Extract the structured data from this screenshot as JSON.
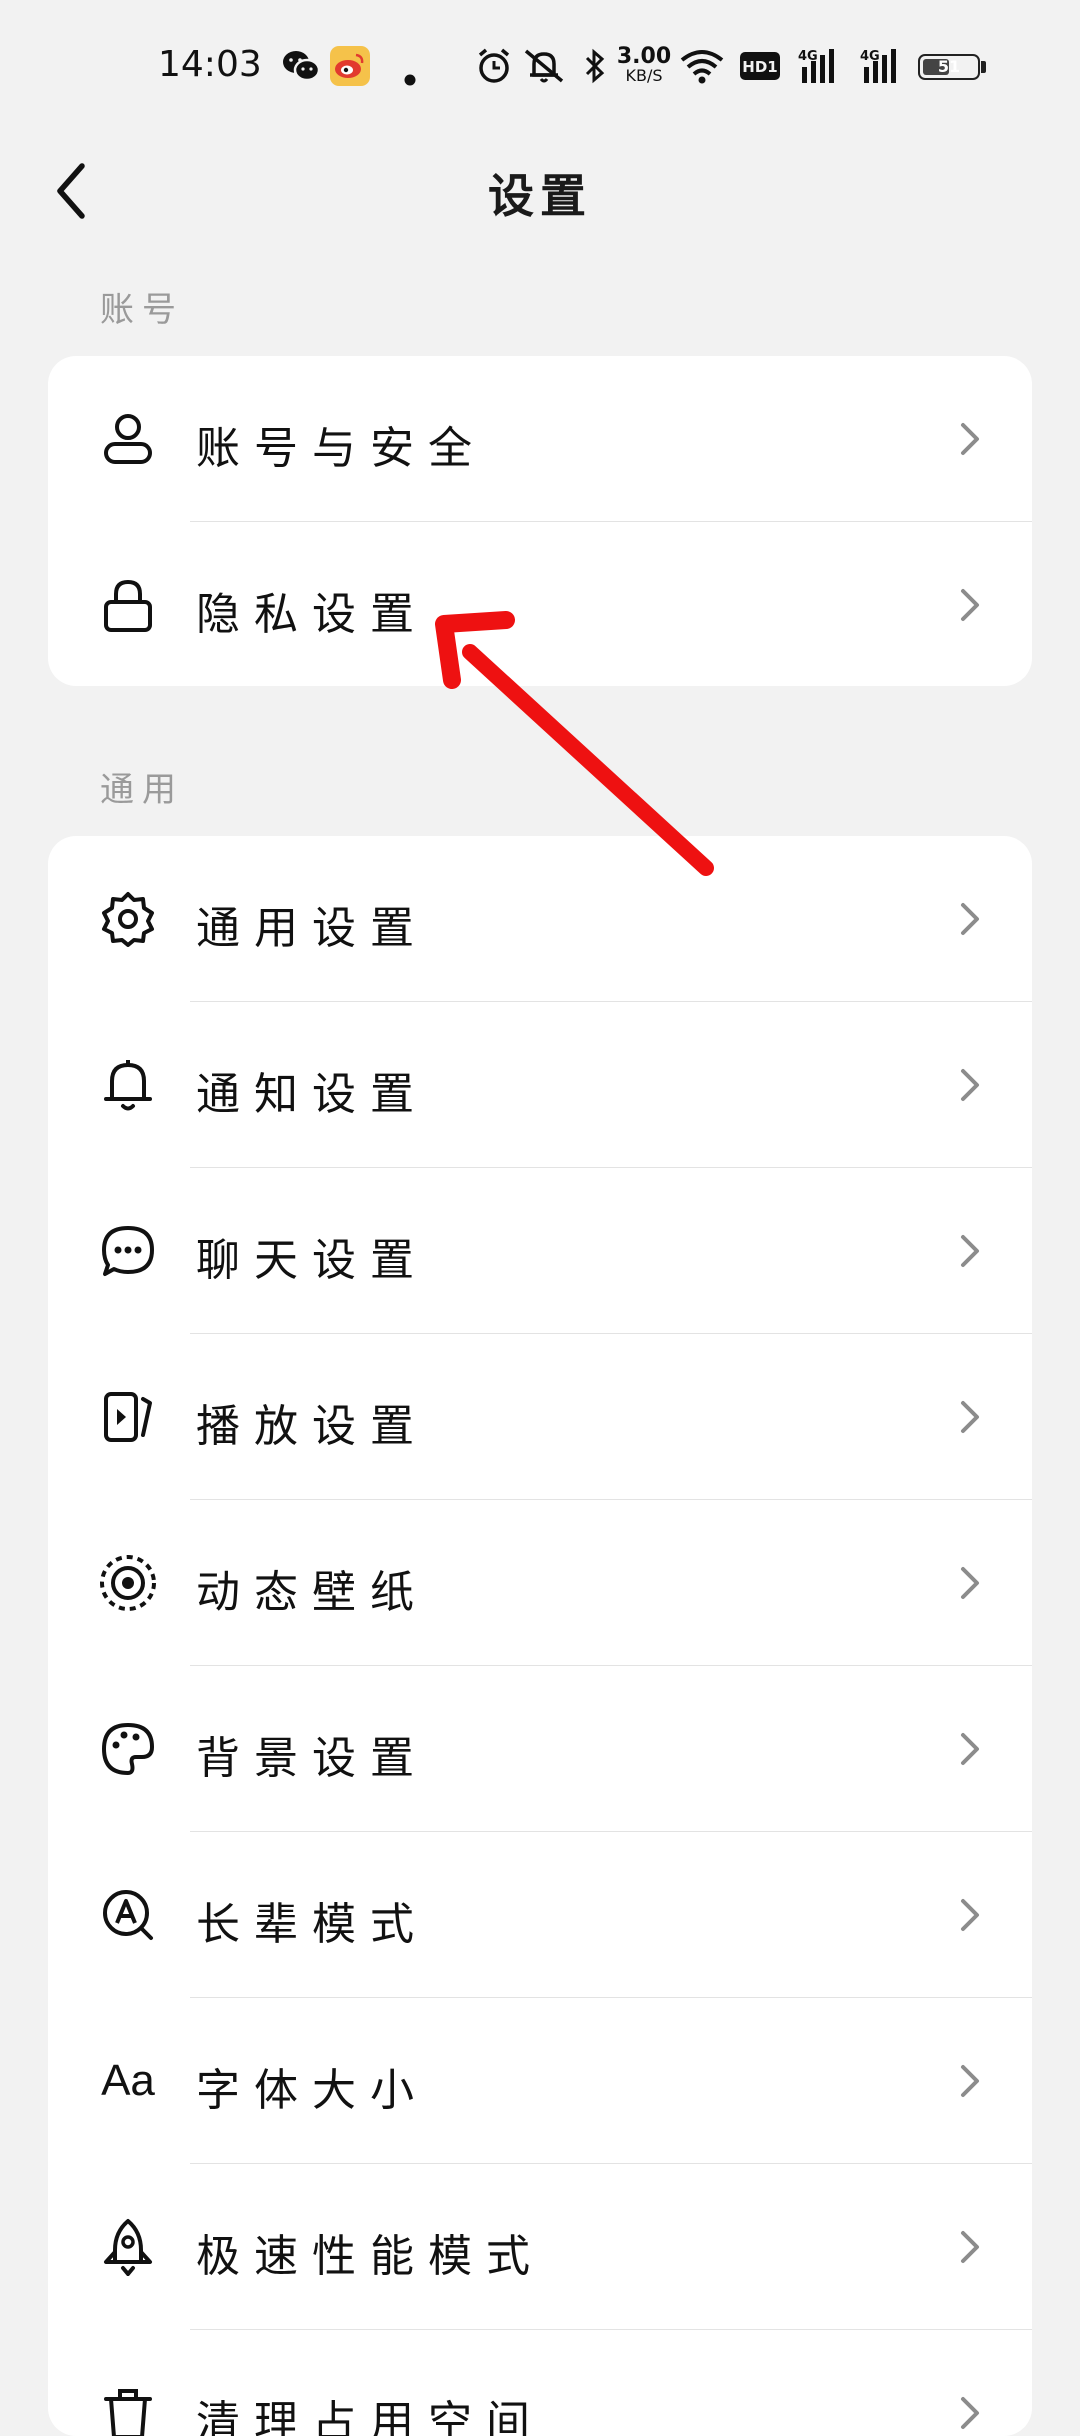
{
  "status_bar": {
    "time": "14:03",
    "speed_value": "3.00",
    "speed_unit": "KB/S",
    "hd_label": "HD1",
    "net1": "4G",
    "net2": "4G",
    "battery": "51",
    "battery_fraction": 0.51,
    "icons": [
      "wechat-icon",
      "weibo-icon",
      "dot-icon",
      "alarm-icon",
      "mute-icon",
      "bluetooth-icon",
      "wifi-icon",
      "hd-icon",
      "signal-icon",
      "signal-icon",
      "battery-icon"
    ]
  },
  "header": {
    "title": "设置",
    "back_icon": "back-chevron-icon"
  },
  "sections": {
    "account": {
      "label": "账号",
      "items": [
        {
          "label": "账号与安全",
          "icon": "user-icon"
        },
        {
          "label": "隐私设置",
          "icon": "lock-icon"
        }
      ]
    },
    "general": {
      "label": "通用",
      "items": [
        {
          "label": "通用设置",
          "icon": "gear-icon"
        },
        {
          "label": "通知设置",
          "icon": "bell-icon"
        },
        {
          "label": "聊天设置",
          "icon": "chat-bubble-icon"
        },
        {
          "label": "播放设置",
          "icon": "play-icon"
        },
        {
          "label": "动态壁纸",
          "icon": "dynamic-wallpaper-icon"
        },
        {
          "label": "背景设置",
          "icon": "palette-icon"
        },
        {
          "label": "长辈模式",
          "icon": "elder-mode-icon"
        },
        {
          "label": "字体大小",
          "icon": "font-size-icon",
          "glyph": "Aa"
        },
        {
          "label": "极速性能模式",
          "icon": "rocket-icon"
        },
        {
          "label": "清理占用空间",
          "icon": "trash-icon"
        }
      ]
    }
  },
  "annotation": {
    "color": "#ee1111",
    "type": "arrow"
  },
  "colors": {
    "background": "#f2f2f2",
    "card": "#ffffff",
    "section_label": "#9a9a9a",
    "chevron": "#8c8c8c"
  }
}
